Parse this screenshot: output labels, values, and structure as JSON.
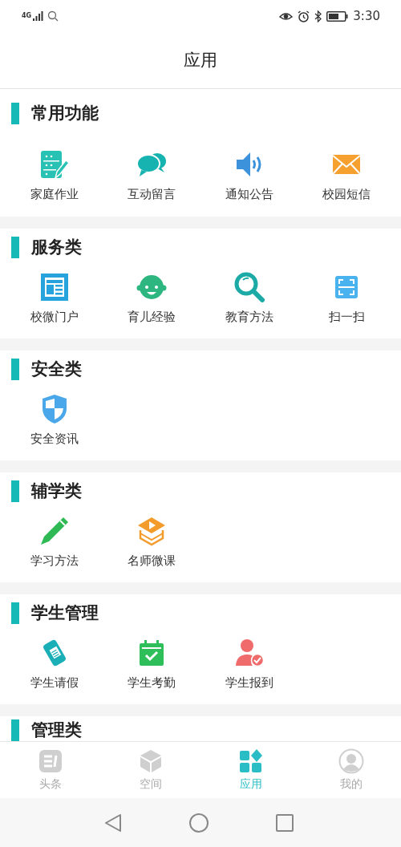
{
  "status_bar": {
    "network": "4G",
    "time": "3:30"
  },
  "title": "应用",
  "sections": [
    {
      "title": "常用功能",
      "items": [
        {
          "label": "家庭作业",
          "kind": "homework"
        },
        {
          "label": "互动留言",
          "kind": "chat"
        },
        {
          "label": "通知公告",
          "kind": "speaker"
        },
        {
          "label": "校园短信",
          "kind": "mail"
        }
      ]
    },
    {
      "title": "服务类",
      "items": [
        {
          "label": "校微门户",
          "kind": "portal"
        },
        {
          "label": "育儿经验",
          "kind": "baby"
        },
        {
          "label": "教育方法",
          "kind": "magnifier"
        },
        {
          "label": "扫一扫",
          "kind": "scan"
        }
      ]
    },
    {
      "title": "安全类",
      "items": [
        {
          "label": "安全资讯",
          "kind": "shield"
        }
      ]
    },
    {
      "title": "辅学类",
      "items": [
        {
          "label": "学习方法",
          "kind": "pencil"
        },
        {
          "label": "名师微课",
          "kind": "video"
        }
      ]
    },
    {
      "title": "学生管理",
      "items": [
        {
          "label": "学生请假",
          "kind": "scroll"
        },
        {
          "label": "学生考勤",
          "kind": "calendar"
        },
        {
          "label": "学生报到",
          "kind": "person"
        }
      ]
    },
    {
      "title": "管理类"
    }
  ],
  "tabs": [
    {
      "label": "头条",
      "kind": "news",
      "selected": false
    },
    {
      "label": "空间",
      "kind": "cube",
      "selected": false
    },
    {
      "label": "应用",
      "kind": "grid",
      "selected": true
    },
    {
      "label": "我的",
      "kind": "user",
      "selected": false
    }
  ]
}
